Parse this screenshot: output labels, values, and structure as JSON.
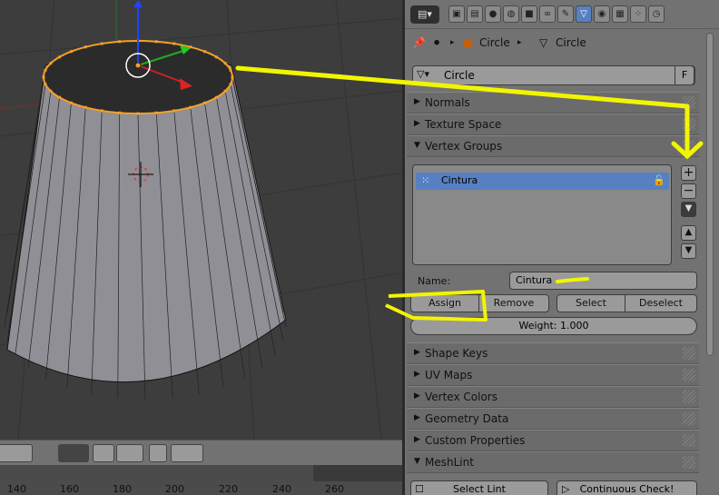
{
  "viewport": {
    "timeline_labels": [
      "140",
      "160",
      "180",
      "200",
      "220",
      "240",
      "260"
    ]
  },
  "properties": {
    "context_tabs": [
      "render",
      "render-layers",
      "scene",
      "world",
      "object",
      "constraints",
      "modifiers",
      "data",
      "material",
      "texture",
      "particles",
      "physics"
    ],
    "breadcrumb": {
      "object": "Circle",
      "mesh": "Circle"
    },
    "mesh_name": "Circle",
    "fake_user_label": "F",
    "panels_top": [
      {
        "title": "Normals",
        "expanded": false
      },
      {
        "title": "Texture Space",
        "expanded": false
      },
      {
        "title": "Vertex Groups",
        "expanded": true
      }
    ],
    "vertex_groups": {
      "items": [
        {
          "name": "Cintura",
          "selected": true
        }
      ],
      "name_label": "Name:",
      "name_value": "Cintura",
      "assign_label": "Assign",
      "remove_label": "Remove",
      "select_label": "Select",
      "deselect_label": "Deselect",
      "weight_label": "Weight: 1.000"
    },
    "panels_bottom": [
      {
        "title": "Shape Keys",
        "expanded": false
      },
      {
        "title": "UV Maps",
        "expanded": false
      },
      {
        "title": "Vertex Colors",
        "expanded": false
      },
      {
        "title": "Geometry Data",
        "expanded": false
      },
      {
        "title": "Custom Properties",
        "expanded": false
      },
      {
        "title": "MeshLint",
        "expanded": true
      }
    ],
    "meshlint": {
      "select_lint_label": "Select Lint",
      "continuous_check_label": "Continuous Check!"
    }
  },
  "colors": {
    "selection": "#5680c2",
    "annotation": "#f2f500",
    "selected_verts": "#f5a028"
  }
}
